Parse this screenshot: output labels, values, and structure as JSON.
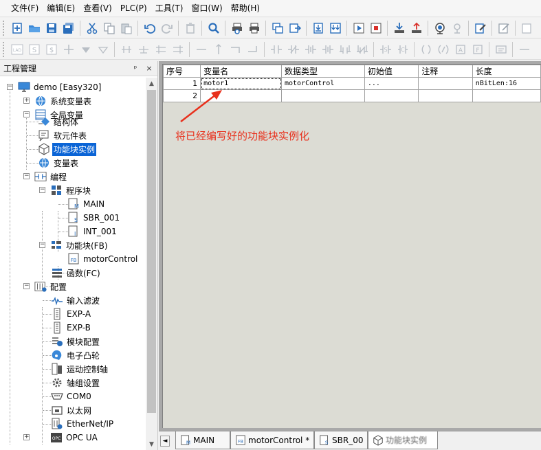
{
  "menu": [
    "文件(F)",
    "编辑(E)",
    "查看(V)",
    "PLC(P)",
    "工具(T)",
    "窗口(W)",
    "帮助(H)"
  ],
  "panel": {
    "title": "工程管理",
    "pin": "ᵖ",
    "close": "×"
  },
  "tree": {
    "root": "demo [Easy320]",
    "system_vars": "系统变量表",
    "global_vars": "全局变量",
    "struct": "结构体",
    "soft_elements": "软元件表",
    "fb_instances": "功能块实例",
    "var_table": "变量表",
    "programming": "编程",
    "program_blocks": "程序块",
    "main": "MAIN",
    "sbr": "SBR_001",
    "int": "INT_001",
    "fb_group": "功能块(FB)",
    "fb_motor": "motorControl",
    "functions": "函数(FC)",
    "config": "配置",
    "input_filter": "输入滤波",
    "exp_a": "EXP-A",
    "exp_b": "EXP-B",
    "module_config": "模块配置",
    "ecam": "电子凸轮",
    "motion_axis": "运动控制轴",
    "axis_group": "轴组设置",
    "com0": "COM0",
    "ethernet": "以太网",
    "ethernetip": "EtherNet/IP",
    "opcua": "OPC UA"
  },
  "grid": {
    "headers": [
      "序号",
      "变量名",
      "数据类型",
      "初始值",
      "注释",
      "长度"
    ],
    "rows": [
      [
        "1",
        "motor1",
        "motorControl",
        "...",
        "",
        "nBitLen:16"
      ],
      [
        "2",
        "",
        "",
        "",
        "",
        ""
      ]
    ]
  },
  "annotation": {
    "text": "将已经编写好的功能块实例化",
    "color": "#e8301c"
  },
  "tabs": {
    "scroll": "◄",
    "main": "MAIN",
    "motor": "motorControl *",
    "sbr": "SBR_00",
    "fbinst": "功能块实例"
  },
  "colors": {
    "selection": "#0a64d6",
    "accent": "#2a6ebb"
  }
}
